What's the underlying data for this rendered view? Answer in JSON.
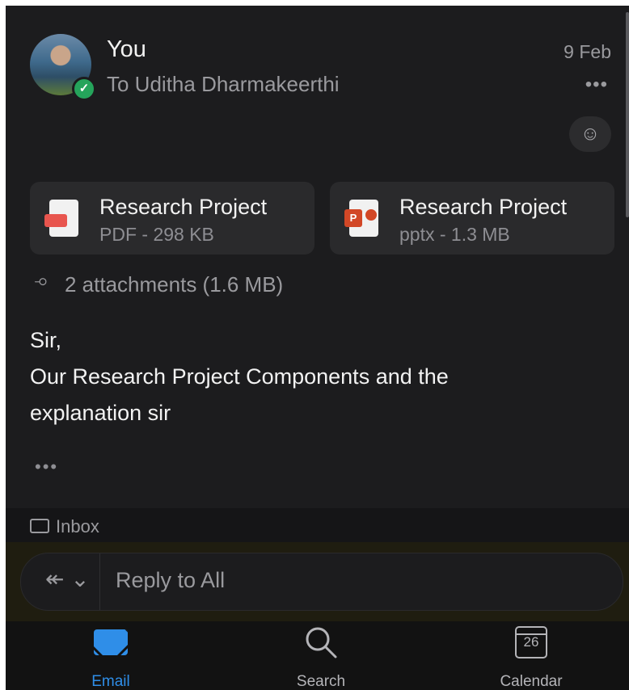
{
  "message": {
    "sender": "You",
    "recipient": "To Uditha Dharmakeerthi",
    "date": "9 Feb",
    "more": "•••",
    "react_icon": "☺"
  },
  "attachments": {
    "files": [
      {
        "title": "Research Project",
        "meta": "PDF - 298 KB"
      },
      {
        "title": "Research Project",
        "meta": "pptx - 1.3 MB"
      }
    ],
    "summary": "2 attachments (1.6 MB)"
  },
  "body": {
    "lines": [
      "Sir,",
      "Our Research Project Components and the",
      "explanation sir"
    ],
    "more": "•••"
  },
  "folder": {
    "label": "Inbox"
  },
  "reply": {
    "placeholder": "Reply to All"
  },
  "tabs": [
    {
      "label": "Email",
      "active": true
    },
    {
      "label": "Search",
      "active": false
    },
    {
      "label": "Calendar",
      "active": false,
      "badge": "26"
    }
  ],
  "colors": {
    "accent": "#2f8ee8",
    "background": "#1c1c1e",
    "text": "#f2f2f2",
    "muted": "#9a9a9e"
  }
}
